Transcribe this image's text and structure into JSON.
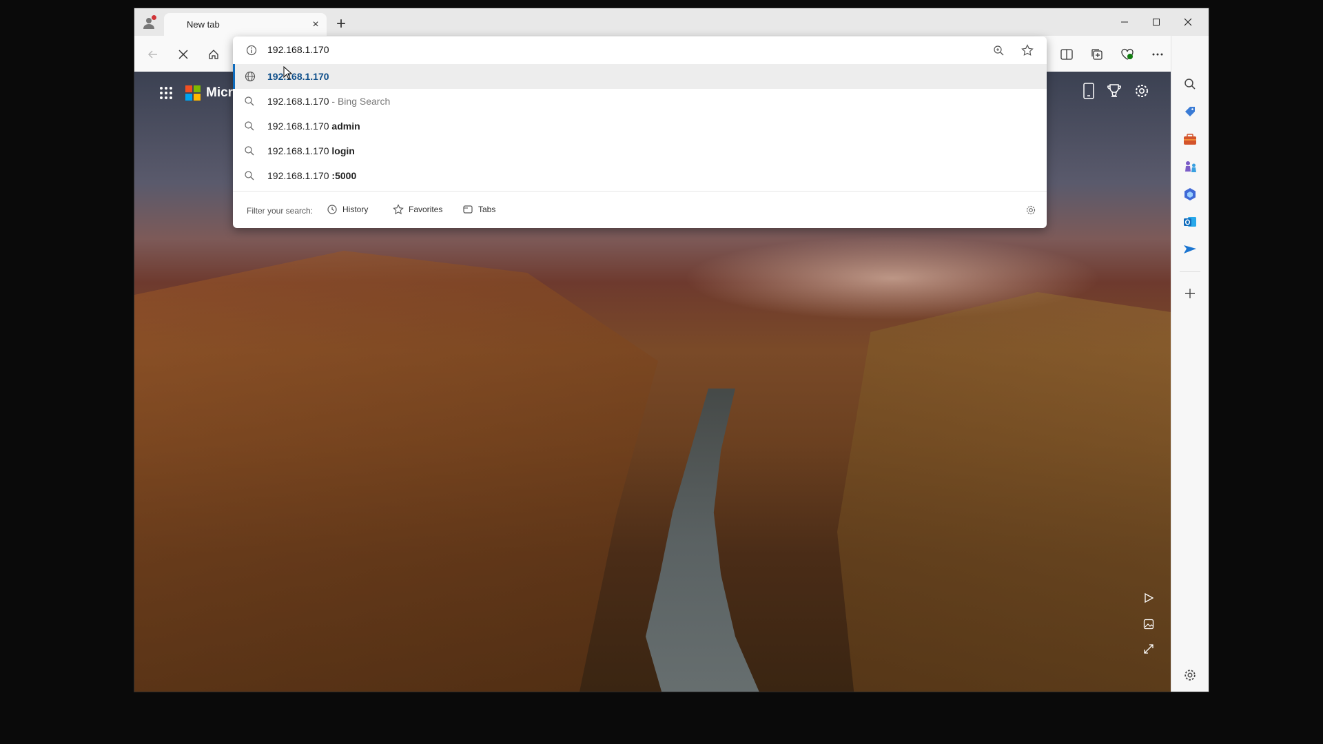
{
  "tab": {
    "title": "New tab"
  },
  "address": {
    "value": "192.168.1.170"
  },
  "suggestions": [
    {
      "prefix": "192.168.1.170",
      "suffix": "",
      "icon": "globe-icon"
    },
    {
      "prefix": "192.168.1.170",
      "suffix": " - Bing Search",
      "icon": "search-icon"
    },
    {
      "prefix": "192.168.1.170",
      "suffix": " admin",
      "icon": "search-icon"
    },
    {
      "prefix": "192.168.1.170",
      "suffix": " login",
      "icon": "search-icon"
    },
    {
      "prefix": "192.168.1.170",
      "suffix": " :5000",
      "icon": "search-icon"
    }
  ],
  "filter": {
    "label": "Filter your search:",
    "chips": [
      "History",
      "Favorites",
      "Tabs"
    ]
  },
  "newtab_page": {
    "brand": "Micr"
  },
  "colors": {
    "accent": "#0f6cbd",
    "badge": "#d13438"
  }
}
